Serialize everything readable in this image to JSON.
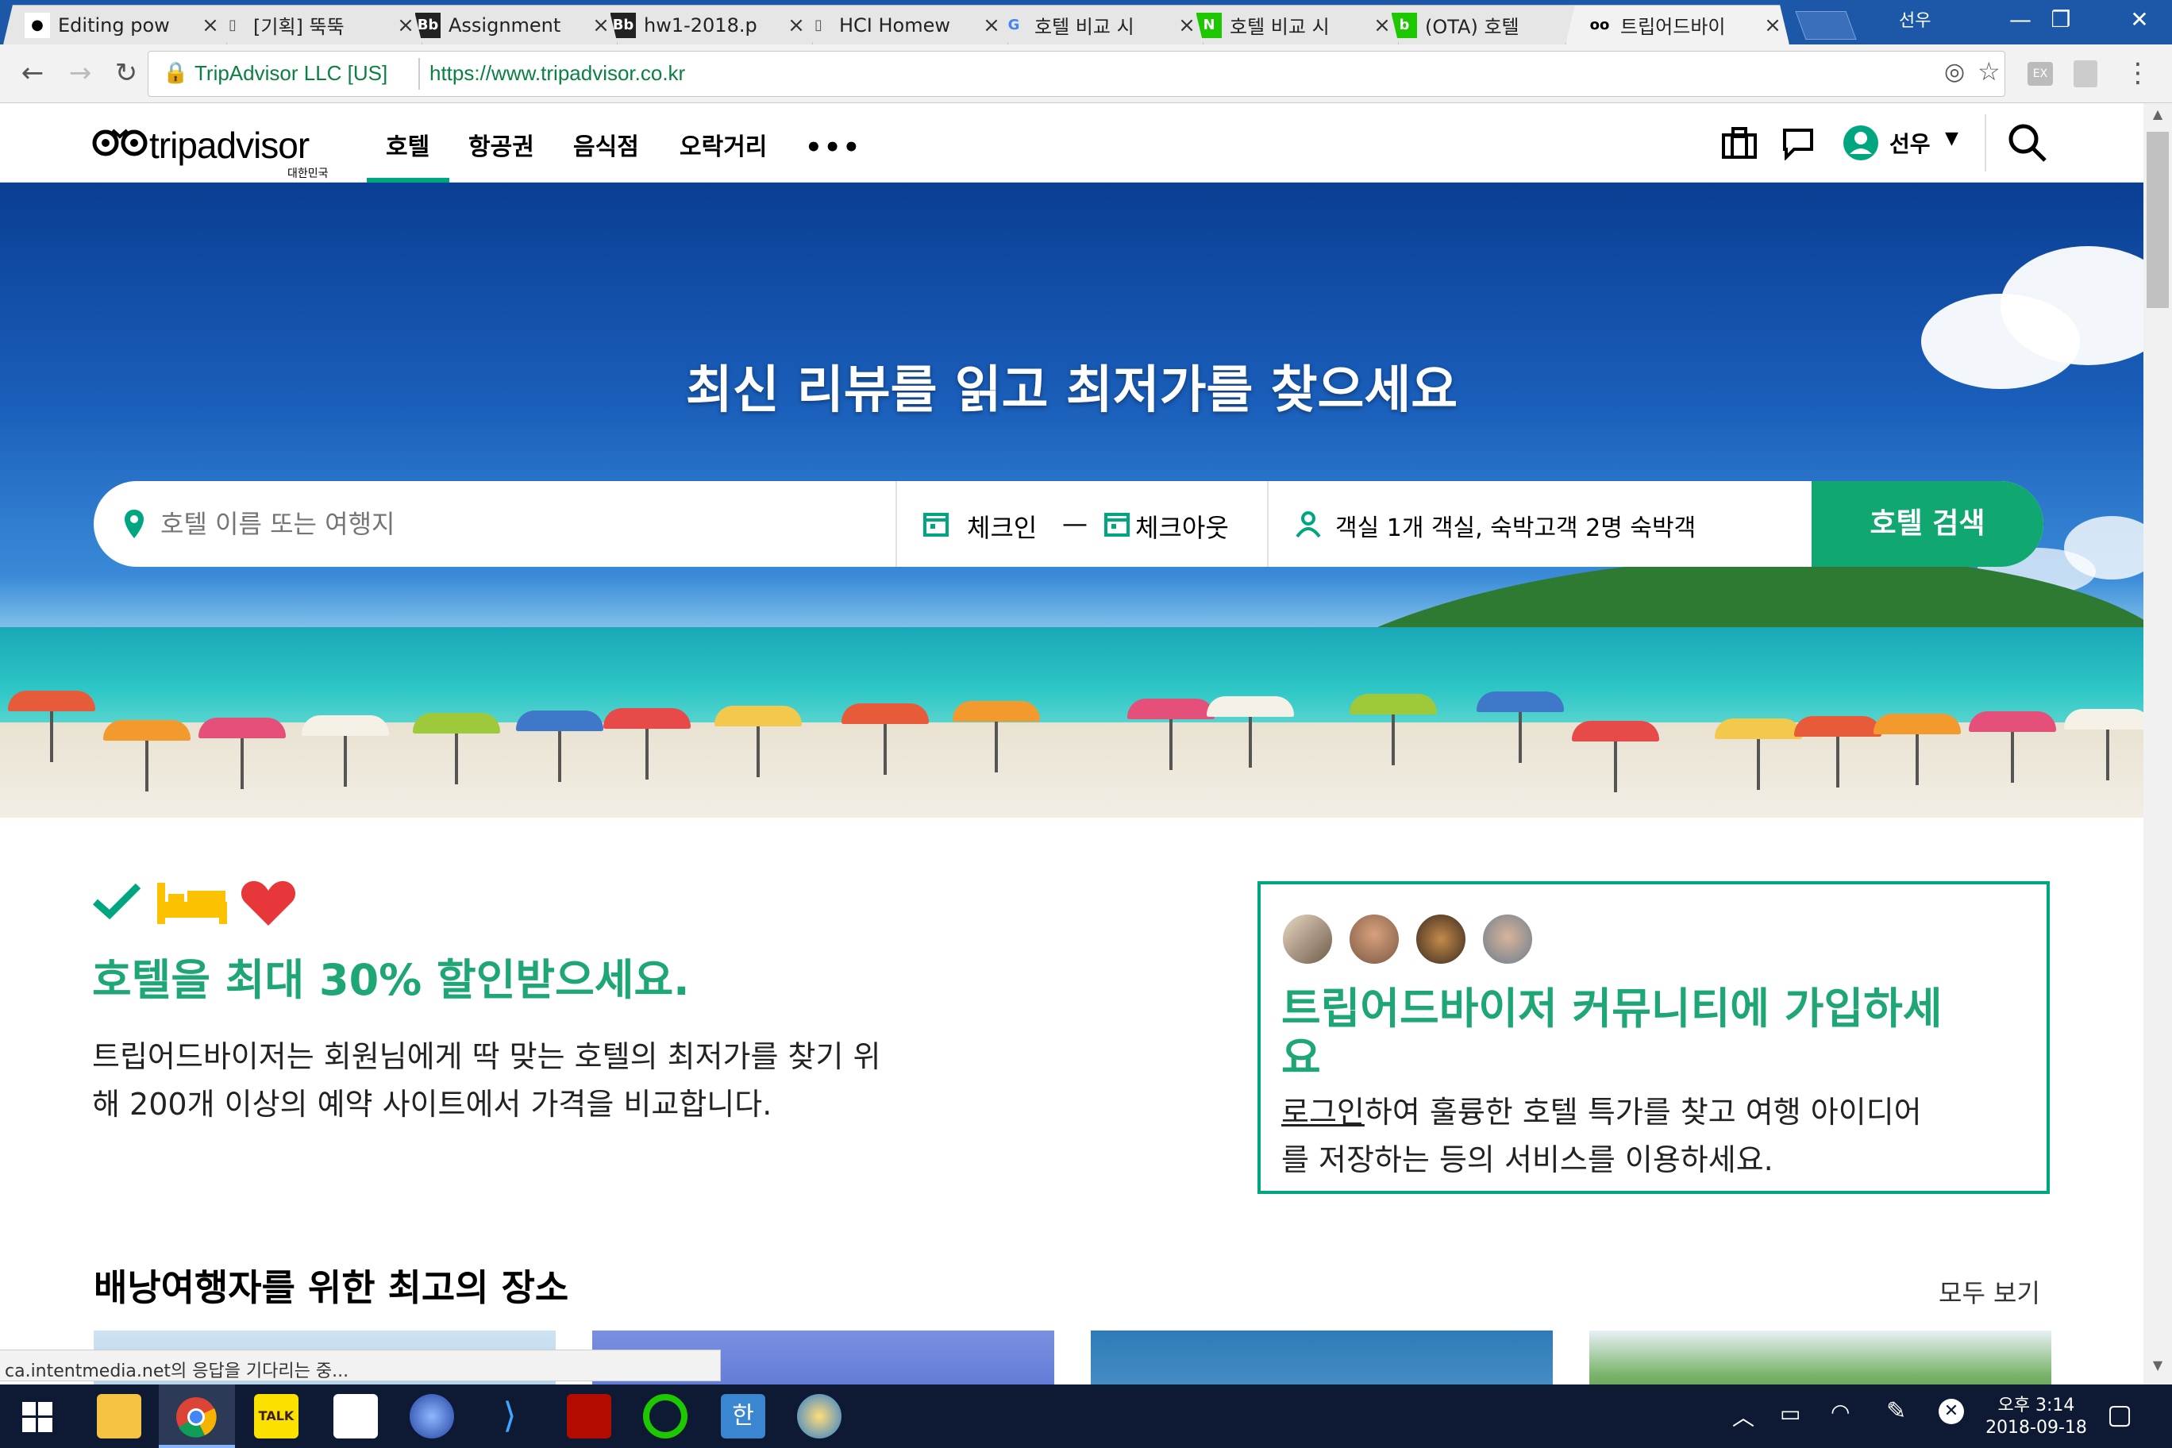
{
  "browser": {
    "tabs": [
      {
        "label": "Editing pow",
        "icon": "github-icon",
        "active": false
      },
      {
        "label": "[기획] 뚝뚝",
        "icon": "doc-icon",
        "active": false
      },
      {
        "label": "Assignment",
        "icon": "blackboard-icon",
        "active": false
      },
      {
        "label": "hw1-2018.p",
        "icon": "blackboard-icon",
        "active": false
      },
      {
        "label": "HCI Homew",
        "icon": "doc-icon",
        "active": false
      },
      {
        "label": "호텔 비교 시",
        "icon": "google-icon",
        "active": false
      },
      {
        "label": "호텔 비교 시",
        "icon": "naver-icon",
        "active": false
      },
      {
        "label": "(OTA) 호텔",
        "icon": "blog-icon",
        "active": false
      },
      {
        "label": "트립어드바이",
        "icon": "tripadvisor-icon",
        "active": true
      }
    ],
    "profile_label": "선우",
    "site_identity": "TripAdvisor LLC [US]",
    "url": "https://www.tripadvisor.co.kr",
    "status_text": "ca.intentmedia.net의 응답을 기다리는 중..."
  },
  "site": {
    "logo_text": "tripadvisor",
    "logo_sub": "대한민국",
    "nav": [
      {
        "label": "호텔",
        "active": true
      },
      {
        "label": "항공권",
        "active": false
      },
      {
        "label": "음식점",
        "active": false
      },
      {
        "label": "오락거리",
        "active": false
      }
    ],
    "more_label": "•••",
    "user_label": "선우"
  },
  "hero": {
    "headline": "최신 리뷰를 읽고 최저가를 찾으세요",
    "search_placeholder": "호텔 이름 또는 여행지",
    "checkin_label": "체크인",
    "dash": "—",
    "checkout_label": "체크아웃",
    "guests_label": "객실 1개 객실, 숙박고객 2명 숙박객",
    "search_button": "호텔 검색"
  },
  "promo": {
    "title": "호텔을 최대 30% 할인받으세요.",
    "body_line1": "트립어드바이저는 회원님에게 딱 맞는 호텔의 최저가를 찾기 위",
    "body_line2": "해 200개 이상의 예약 사이트에서 가격을 비교합니다."
  },
  "community": {
    "title_line1": "트립어드바이저 커뮤니티에 가입하세",
    "title_line2": "요",
    "login_link": "로그인",
    "body_line1": "하여 훌륭한 호텔 특가를 찾고 여행 아이디어",
    "body_line2": "를 저장하는 등의 서비스를 이용하세요."
  },
  "section": {
    "title": "배낭여행자를 위한 최고의 장소",
    "see_all": "모두 보기"
  },
  "taskbar": {
    "time": "오후 3:14",
    "date": "2018-09-18"
  },
  "colors": {
    "accent_green": "#00a680",
    "tab_strip_blue": "#1c57a8",
    "taskbar": "#0e1a33"
  }
}
